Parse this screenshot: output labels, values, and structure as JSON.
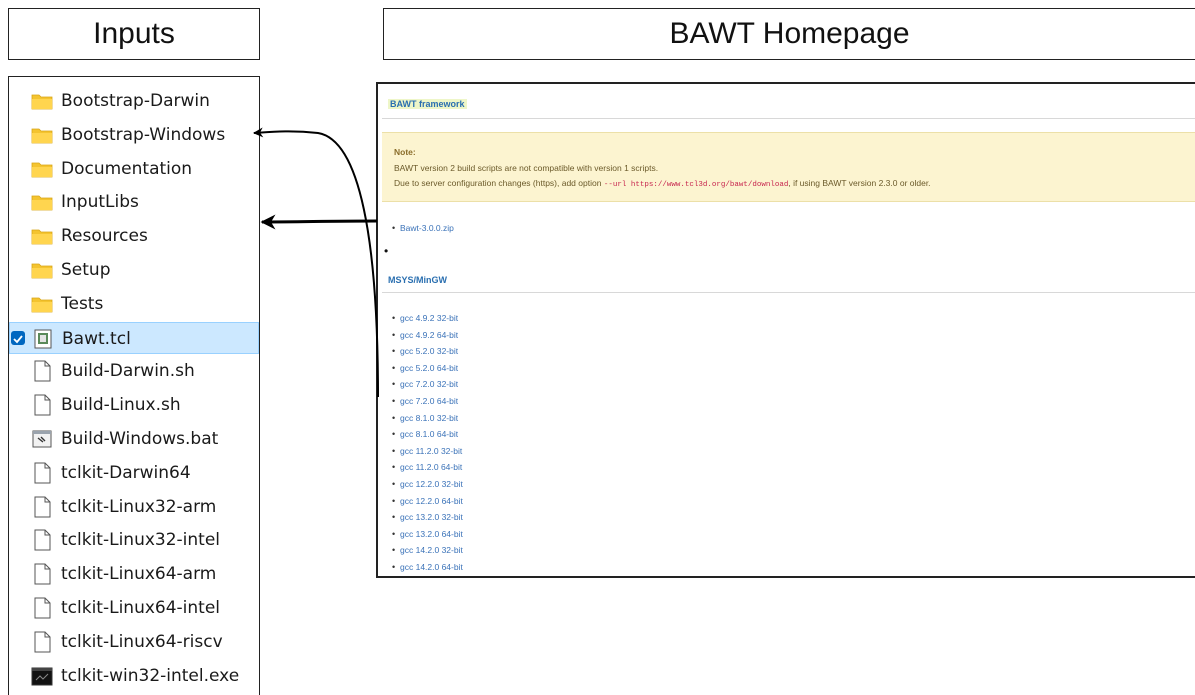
{
  "titles": {
    "inputs": "Inputs",
    "homepage": "BAWT Homepage"
  },
  "files": [
    {
      "name": "Bootstrap-Darwin",
      "icon": "folder-icon"
    },
    {
      "name": "Bootstrap-Windows",
      "icon": "folder-icon"
    },
    {
      "name": "Documentation",
      "icon": "folder-icon"
    },
    {
      "name": "InputLibs",
      "icon": "folder-icon"
    },
    {
      "name": "Resources",
      "icon": "folder-icon"
    },
    {
      "name": "Setup",
      "icon": "folder-icon"
    },
    {
      "name": "Tests",
      "icon": "folder-icon"
    },
    {
      "name": "Bawt.tcl",
      "icon": "tcl-script-icon",
      "selected": true
    },
    {
      "name": "Build-Darwin.sh",
      "icon": "file-icon"
    },
    {
      "name": "Build-Linux.sh",
      "icon": "file-icon"
    },
    {
      "name": "Build-Windows.bat",
      "icon": "batch-file-icon"
    },
    {
      "name": "tclkit-Darwin64",
      "icon": "file-icon"
    },
    {
      "name": "tclkit-Linux32-arm",
      "icon": "file-icon"
    },
    {
      "name": "tclkit-Linux32-intel",
      "icon": "file-icon"
    },
    {
      "name": "tclkit-Linux64-arm",
      "icon": "file-icon"
    },
    {
      "name": "tclkit-Linux64-intel",
      "icon": "file-icon"
    },
    {
      "name": "tclkit-Linux64-riscv",
      "icon": "file-icon"
    },
    {
      "name": "tclkit-win32-intel.exe",
      "icon": "exe-icon"
    }
  ],
  "homepage": {
    "framework_heading": "BAWT framework",
    "note_label": "Note:",
    "note_line1": "BAWT version 2 build scripts are not compatible with version 1 scripts.",
    "note_line2_pre": "Due to server configuration changes (https), add option",
    "note_code": "--url https://www.tcl3d.org/bawt/download",
    "note_line2_post": ", if using BAWT version 2.3.0 or older.",
    "download_link": "Bawt-3.0.0.zip",
    "msys_heading": "MSYS/MinGW",
    "gcc_links": [
      "gcc 4.9.2 32-bit",
      "gcc 4.9.2 64-bit",
      "gcc 5.2.0 32-bit",
      "gcc 5.2.0 64-bit",
      "gcc 7.2.0 32-bit",
      "gcc 7.2.0 64-bit",
      "gcc 8.1.0 32-bit",
      "gcc 8.1.0 64-bit",
      "gcc 11.2.0 32-bit",
      "gcc 11.2.0 64-bit",
      "gcc 12.2.0 32-bit",
      "gcc 12.2.0 64-bit",
      "gcc 13.2.0 32-bit",
      "gcc 13.2.0 64-bit",
      "gcc 14.2.0 32-bit",
      "gcc 14.2.0 64-bit"
    ]
  },
  "colors": {
    "folder": "#f4c430",
    "selection": "#cce8ff",
    "link": "#3a72b8",
    "note_bg": "#fcf4d0"
  }
}
